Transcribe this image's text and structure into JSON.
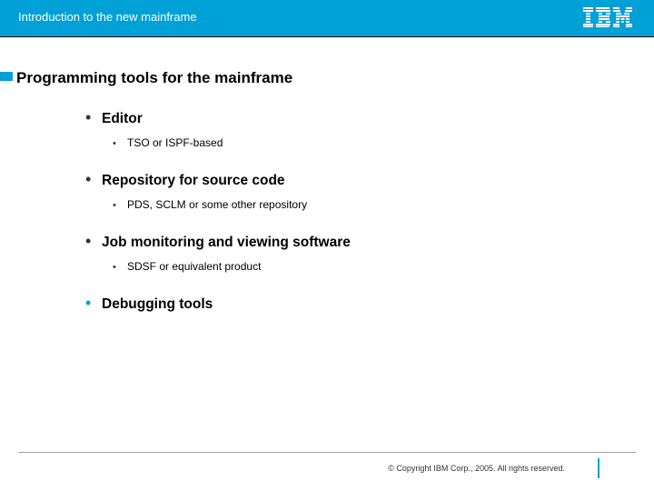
{
  "header": {
    "course_title": "Introduction to the new mainframe",
    "logo_alt": "IBM"
  },
  "slide": {
    "title": "Programming tools for the mainframe",
    "items": [
      {
        "label": "Editor",
        "sub": "TSO or ISPF-based",
        "accent": false
      },
      {
        "label": "Repository for source code",
        "sub": "PDS, SCLM or some other repository",
        "accent": false
      },
      {
        "label": "Job monitoring and viewing software",
        "sub": "SDSF or equivalent product",
        "accent": false
      },
      {
        "label": "Debugging tools",
        "sub": null,
        "accent": true
      }
    ]
  },
  "footer": {
    "copyright": "© Copyright IBM Corp., 2005. All rights reserved."
  }
}
